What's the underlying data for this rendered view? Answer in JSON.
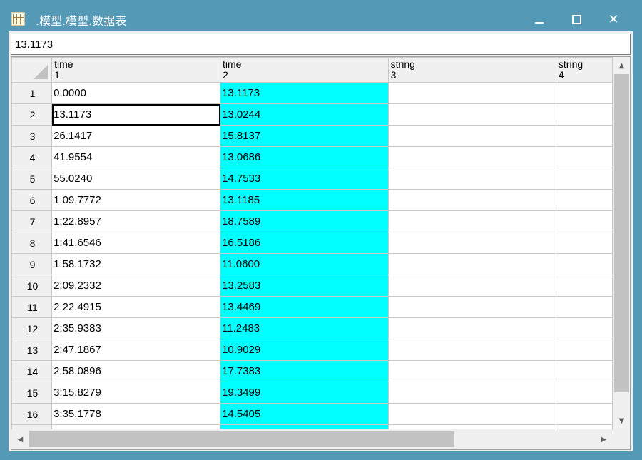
{
  "window": {
    "title": ".模型.模型.数据表",
    "minimize_icon": "minimize-icon",
    "maximize_icon": "maximize-icon",
    "close_glyph": "✕"
  },
  "formula_bar": {
    "value": "13.1173"
  },
  "columns": [
    {
      "type": "time",
      "index": "1"
    },
    {
      "type": "time",
      "index": "2"
    },
    {
      "type": "string",
      "index": "3"
    },
    {
      "type": "string",
      "index": "4"
    }
  ],
  "rows": [
    {
      "n": "1",
      "c1": "0.0000",
      "c2": "13.1173"
    },
    {
      "n": "2",
      "c1": "13.1173",
      "c2": "13.0244"
    },
    {
      "n": "3",
      "c1": "26.1417",
      "c2": "15.8137"
    },
    {
      "n": "4",
      "c1": "41.9554",
      "c2": "13.0686"
    },
    {
      "n": "5",
      "c1": "55.0240",
      "c2": "14.7533"
    },
    {
      "n": "6",
      "c1": "1:09.7772",
      "c2": "13.1185"
    },
    {
      "n": "7",
      "c1": "1:22.8957",
      "c2": "18.7589"
    },
    {
      "n": "8",
      "c1": "1:41.6546",
      "c2": "16.5186"
    },
    {
      "n": "9",
      "c1": "1:58.1732",
      "c2": "11.0600"
    },
    {
      "n": "10",
      "c1": "2:09.2332",
      "c2": "13.2583"
    },
    {
      "n": "11",
      "c1": "2:22.4915",
      "c2": "13.4469"
    },
    {
      "n": "12",
      "c1": "2:35.9383",
      "c2": "11.2483"
    },
    {
      "n": "13",
      "c1": "2:47.1867",
      "c2": "10.9029"
    },
    {
      "n": "14",
      "c1": "2:58.0896",
      "c2": "17.7383"
    },
    {
      "n": "15",
      "c1": "3:15.8279",
      "c2": "19.3499"
    },
    {
      "n": "16",
      "c1": "3:35.1778",
      "c2": "14.5405"
    }
  ],
  "selected_row": "2",
  "colors": {
    "highlight_column": "#00ffff",
    "title_bar": "#5499b5"
  },
  "scrollbars": {
    "up_glyph": "▲",
    "down_glyph": "▼",
    "left_glyph": "◀",
    "right_glyph": "▶"
  }
}
